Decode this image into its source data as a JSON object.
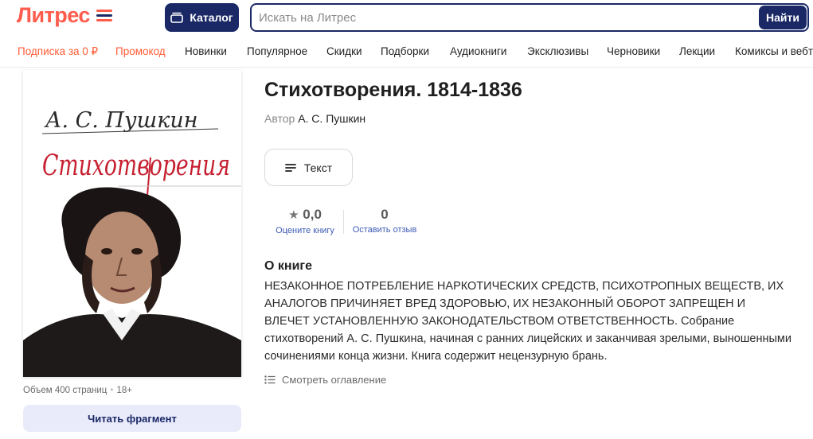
{
  "header": {
    "logo_text": "Литрес",
    "catalog_label": "Каталог",
    "search_placeholder": "Искать на Литрес",
    "search_button": "Найти"
  },
  "nav": {
    "items": [
      {
        "label": "Подписка за 0 ₽",
        "accent": true
      },
      {
        "label": "Промокод",
        "accent": true
      },
      {
        "label": "Новинки",
        "accent": false
      },
      {
        "label": "Популярное",
        "accent": false
      },
      {
        "label": "Скидки",
        "accent": false
      },
      {
        "label": "Подборки",
        "accent": false
      },
      {
        "label": "Аудиокниги",
        "accent": false
      },
      {
        "label": "Эксклюзивы",
        "accent": false
      },
      {
        "label": "Черновики",
        "accent": false
      },
      {
        "label": "Лекции",
        "accent": false
      },
      {
        "label": "Комиксы и вебт",
        "accent": false
      }
    ]
  },
  "cover": {
    "author_script": "А. С. Пушкин",
    "title_script": "Стихотворения"
  },
  "book": {
    "title": "Стихотворения. 1814-1836",
    "author_prefix": "Автор",
    "author": "А. С. Пушкин",
    "format_label": "Текст",
    "meta_pages": "Объем 400 страниц",
    "meta_age": "18+",
    "read_fragment": "Читать фрагмент"
  },
  "stats": {
    "rating_value": "0,0",
    "rating_label": "Оцените книгу",
    "reviews_value": "0",
    "reviews_label": "Оставить отзыв"
  },
  "about": {
    "heading": "О книге",
    "text": "НЕЗАКОННОЕ ПОТРЕБЛЕНИЕ НАРКОТИЧЕСКИХ СРЕДСТВ, ПСИХОТРОПНЫХ ВЕЩЕСТВ, ИХ АНАЛОГОВ ПРИЧИНЯЕТ ВРЕД ЗДОРОВЬЮ, ИХ НЕЗАКОННЫЙ ОБОРОТ ЗАПРЕЩЕН И ВЛЕЧЕТ УСТАНОВЛЕННУЮ ЗАКОНОДАТЕЛЬСТВОМ ОТВЕТСТВЕННОСТЬ. Собрание стихотворений А. С. Пушкина, начиная с ранних лицейских и заканчивая зрелыми, выношенными сочинениями конца жизни. Книга содержит нецензурную брань.",
    "toc_link": "Смотреть оглавление"
  },
  "colors": {
    "brand_orange": "#ff5c4d",
    "brand_navy": "#1a2866",
    "link_blue": "#3d5bb5",
    "fragment_bg": "#e9ebfb"
  },
  "icons": {
    "catalog": "book-stack-icon",
    "format": "text-lines-icon",
    "rating": "star-icon",
    "toc": "list-icon",
    "logo_mark": "stripes-logo-icon"
  }
}
